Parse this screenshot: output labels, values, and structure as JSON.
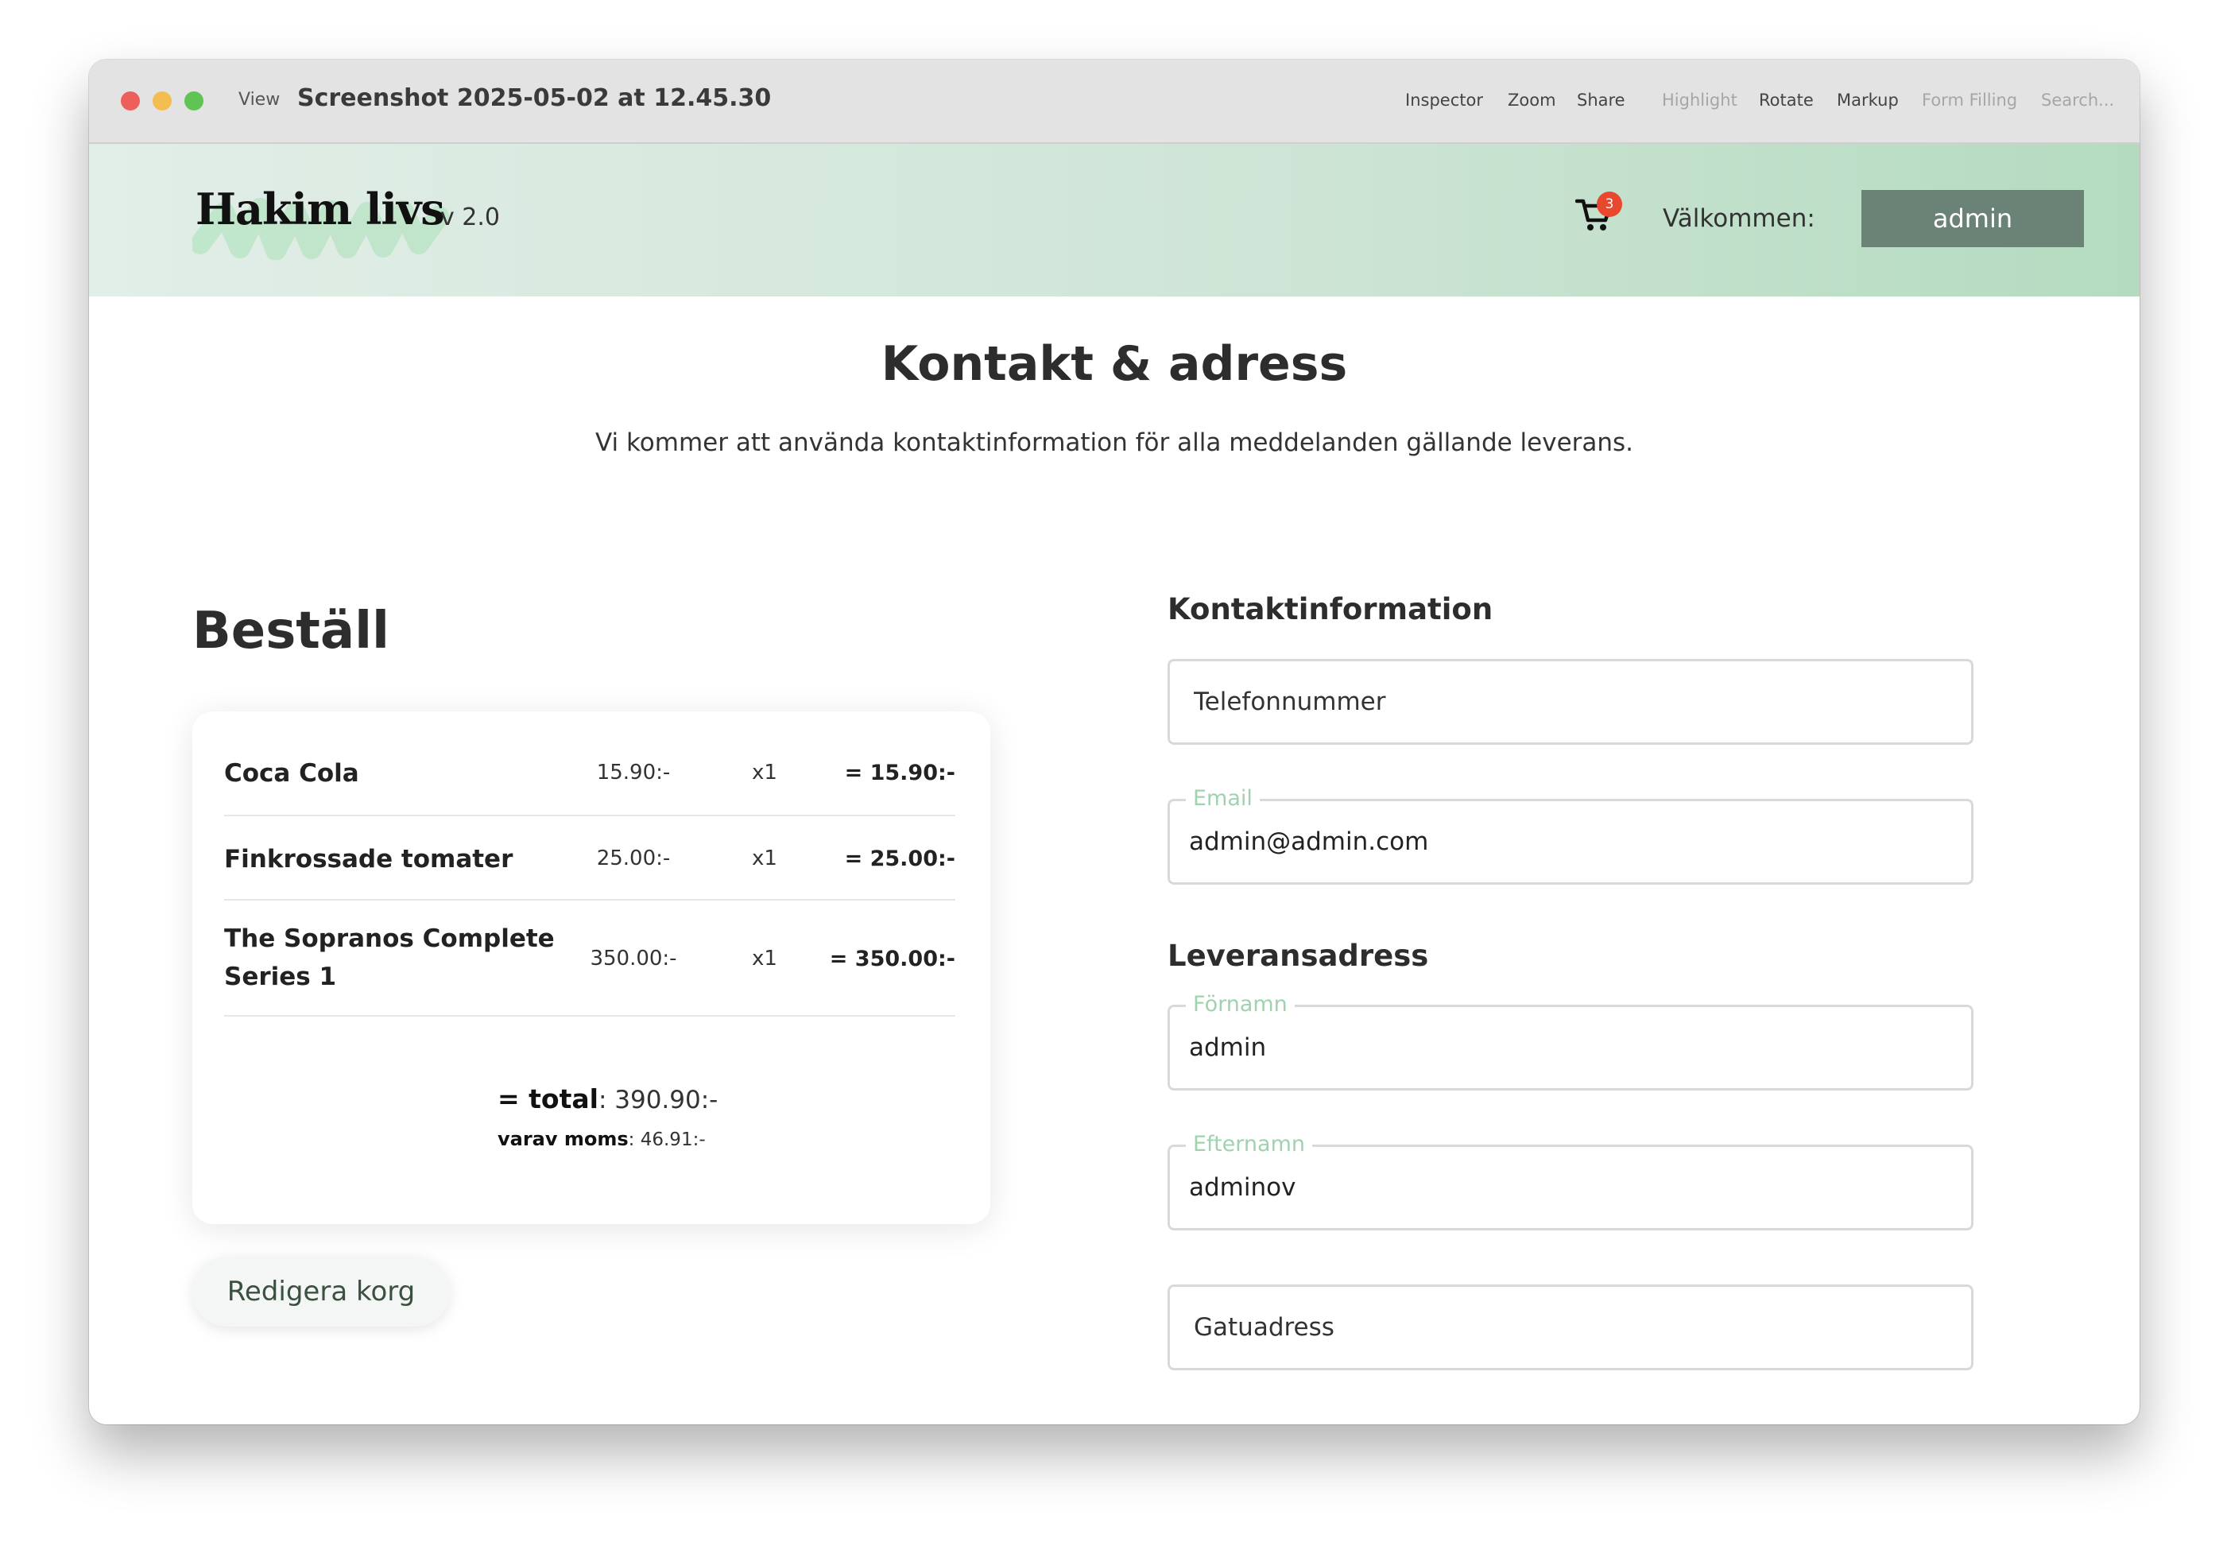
{
  "window": {
    "view_label": "View",
    "title": "Screenshot 2025-05-02 at 12.45.30",
    "toolbar": [
      {
        "label": "Inspector",
        "enabled": true
      },
      {
        "label": "Zoom",
        "enabled": true
      },
      {
        "label": "Share",
        "enabled": true
      },
      {
        "label": "Highlight",
        "enabled": false
      },
      {
        "label": "Rotate",
        "enabled": true
      },
      {
        "label": "Markup",
        "enabled": true
      },
      {
        "label": "Form Filling",
        "enabled": false
      },
      {
        "label": "Search...",
        "enabled": false
      }
    ]
  },
  "header": {
    "logo": "Hakim livs",
    "version": "v 2.0",
    "cart_icon": "shopping-cart-icon",
    "cart_count": "3",
    "welcome": "Välkommen:",
    "user_button": "admin",
    "colors": {
      "gradient_start": "#e2eee8",
      "gradient_end": "#b4dbc0",
      "user_button_bg": "#6b8276",
      "badge": "#e8482e"
    }
  },
  "page": {
    "title": "Kontakt & adress",
    "subtitle": "Vi kommer att använda kontaktinformation för alla meddelanden gällande leverans."
  },
  "order": {
    "title": "Beställ",
    "items": [
      {
        "name": "Coca Cola",
        "price": "15.90:-",
        "qty": "x1",
        "sum": "= 15.90:-"
      },
      {
        "name": "Finkrossade tomater",
        "price": "25.00:-",
        "qty": "x1",
        "sum": "= 25.00:-"
      },
      {
        "name": "The Sopranos Complete Series 1",
        "price": "350.00:-",
        "qty": "x1",
        "sum": "= 350.00:-"
      }
    ],
    "total_label": "= total",
    "total_value": ": 390.90:-",
    "moms_label": "varav moms",
    "moms_value": ": 46.91:-",
    "edit_button": "Redigera korg"
  },
  "contact": {
    "section_title": "Kontaktinformation",
    "phone": {
      "placeholder": "Telefonnummer",
      "value": ""
    },
    "email": {
      "label": "Email",
      "value": "admin@admin.com"
    }
  },
  "delivery": {
    "section_title": "Leveransadress",
    "firstname": {
      "label": "Förnamn",
      "value": "admin"
    },
    "lastname": {
      "label": "Efternamn",
      "value": "adminov"
    },
    "street": {
      "placeholder": "Gatuadress",
      "value": ""
    },
    "accent_color": "#9fd3ae"
  }
}
